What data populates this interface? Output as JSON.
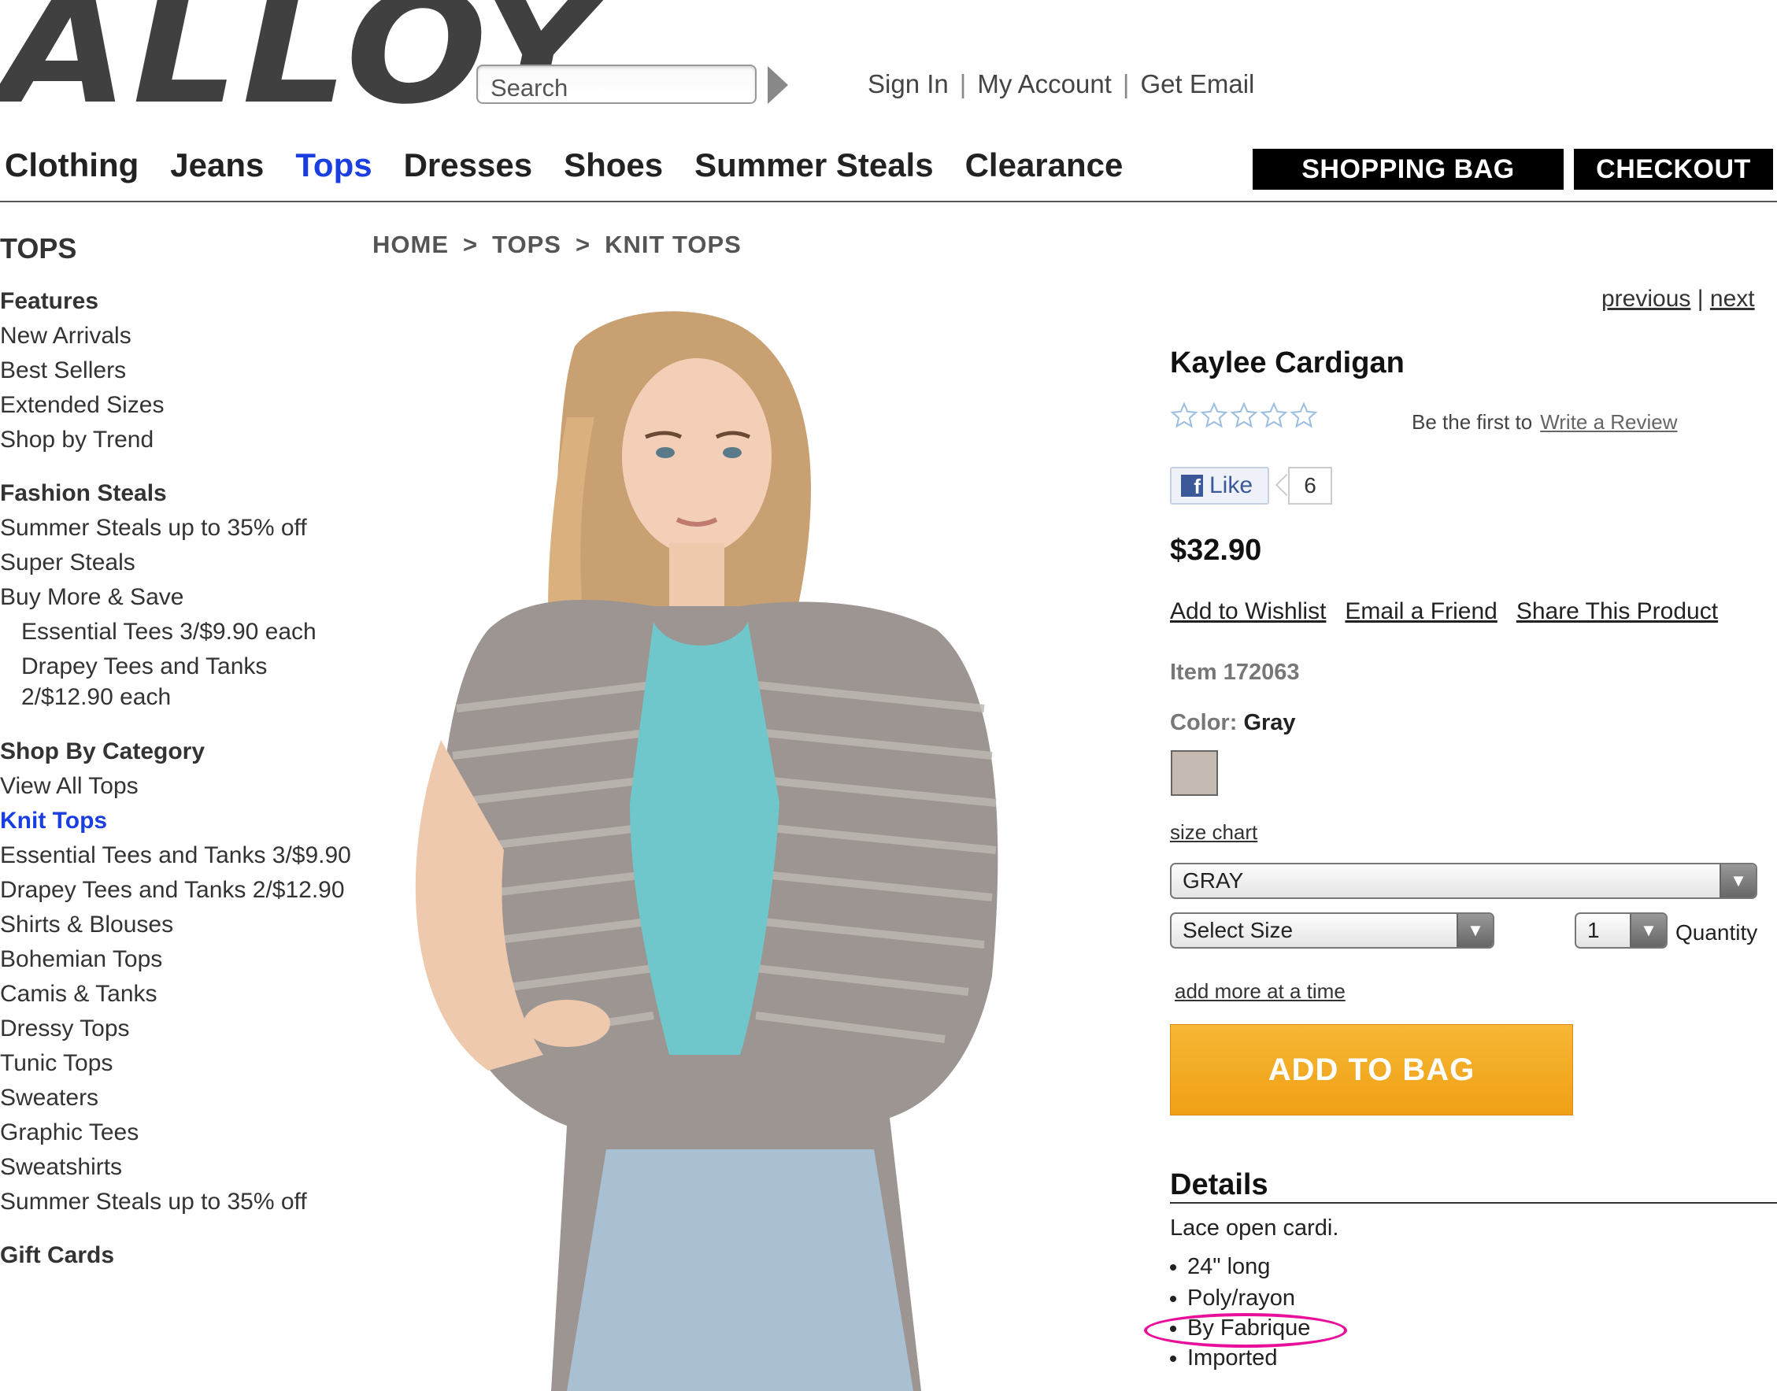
{
  "header": {
    "logo_text": "ALLOY",
    "search_placeholder": "Search",
    "links": [
      "Sign In",
      "My Account",
      "Get Email"
    ]
  },
  "nav": {
    "items": [
      "Clothing",
      "Jeans",
      "Tops",
      "Dresses",
      "Shoes",
      "Summer Steals",
      "Clearance"
    ],
    "active": "Tops",
    "shopping_bag": "SHOPPING BAG",
    "checkout": "CHECKOUT"
  },
  "breadcrumb": [
    "HOME",
    "TOPS",
    "KNIT TOPS"
  ],
  "breadcrumb_sep": ">",
  "sidebar": {
    "title": "TOPS",
    "features_heading": "Features",
    "features": [
      "New Arrivals",
      "Best Sellers",
      "Extended Sizes",
      "Shop by Trend"
    ],
    "steals_heading": "Fashion Steals",
    "steals": [
      "Summer Steals up to 35% off",
      "Super Steals",
      "Buy More & Save"
    ],
    "steals_sub": [
      "Essential Tees 3/$9.90 each",
      "Drapey Tees and Tanks",
      "2/$12.90 each"
    ],
    "category_heading": "Shop By Category",
    "categories": [
      "View All Tops",
      "Knit Tops",
      "Essential Tees and Tanks 3/$9.90",
      "Drapey Tees and Tanks 2/$12.90",
      "Shirts & Blouses",
      "Bohemian Tops",
      "Camis & Tanks",
      "Dressy Tops",
      "Tunic Tops",
      "Sweaters",
      "Graphic Tees",
      "Sweatshirts",
      "Summer Steals up to 35% off"
    ],
    "active_category": "Knit Tops",
    "gift_cards": "Gift Cards"
  },
  "product": {
    "pager_previous": "previous",
    "pager_sep": "|",
    "pager_next": "next",
    "title": "Kaylee Cardigan",
    "rating_stars": 0,
    "rating_max": 5,
    "review_prompt": "Be the first to",
    "review_link": "Write a Review",
    "like_label": "Like",
    "like_count": "6",
    "price": "$32.90",
    "actions": [
      "Add to Wishlist",
      "Email a Friend",
      "Share This Product"
    ],
    "item_number": "Item 172063",
    "color_label": "Color:",
    "color_value": "Gray",
    "swatch_color": "#c4bab1",
    "size_chart": "size chart",
    "color_select": "GRAY",
    "size_select": "Select Size",
    "quantity_value": "1",
    "quantity_label": "Quantity",
    "add_more": "add more at a time",
    "add_to_bag": "ADD TO BAG",
    "add_to_bag_color": "#f4a823",
    "details_heading": "Details",
    "details_desc": "Lace open cardi.",
    "details_bullets": [
      "24\" long",
      "Poly/rayon",
      "By Fabrique",
      "Imported"
    ],
    "annotation_color": "#e8109a"
  },
  "colors": {
    "active_link": "#1a3ee0",
    "button_black": "#000000"
  }
}
